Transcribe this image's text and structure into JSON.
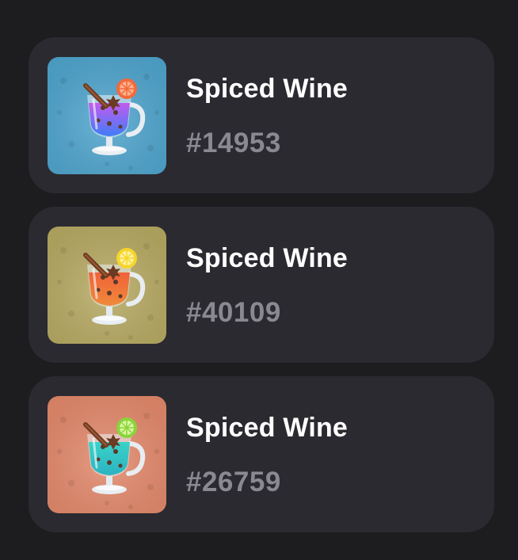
{
  "items": [
    {
      "title": "Spiced Wine",
      "number": "#14953",
      "icon": "spiced-wine-glass-icon",
      "background": "#4fa6cf",
      "drink_top": "#c25cf0",
      "drink_bottom": "#3f7cf6",
      "fruit": "#f26a3c",
      "fruit_inner": "#ffb08a"
    },
    {
      "title": "Spiced Wine",
      "number": "#40109",
      "icon": "spiced-wine-glass-icon",
      "background": "#b8ab63",
      "drink_top": "#f0623a",
      "drink_bottom": "#f08a3a",
      "fruit": "#f7d42a",
      "fruit_inner": "#fff2a0"
    },
    {
      "title": "Spiced Wine",
      "number": "#26759",
      "icon": "spiced-wine-glass-icon",
      "background": "#e58a6c",
      "drink_top": "#3ad2c8",
      "drink_bottom": "#2bb3c2",
      "fruit": "#8ad43a",
      "fruit_inner": "#d8f5a0"
    }
  ]
}
